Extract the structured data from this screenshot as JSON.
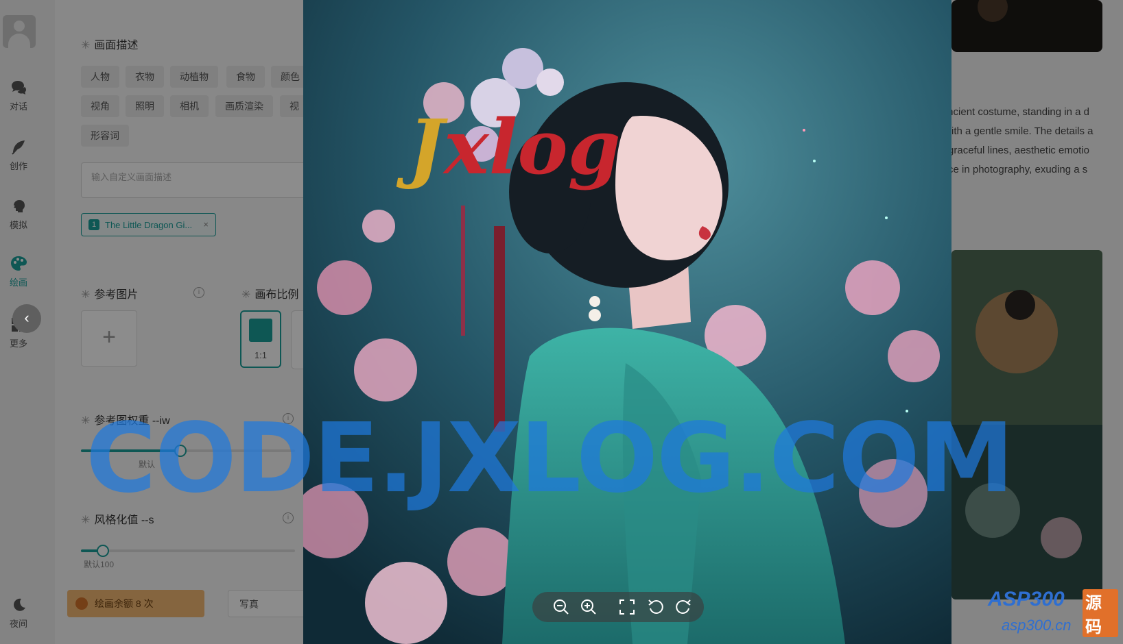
{
  "nav": {
    "items": [
      {
        "label": "对话",
        "icon": "chat-icon"
      },
      {
        "label": "创作",
        "icon": "feather-icon"
      },
      {
        "label": "模拟",
        "icon": "head-icon"
      },
      {
        "label": "绘画",
        "icon": "palette-icon"
      },
      {
        "label": "更多",
        "icon": "grid-icon"
      }
    ],
    "night_label": "夜间",
    "collapse_glyph": "‹"
  },
  "panel": {
    "desc_title": "画面描述",
    "tags_row1": [
      "人物",
      "衣物",
      "动植物",
      "食物",
      "颜色"
    ],
    "tags_row2": [
      "视角",
      "照明",
      "相机",
      "画质渲染",
      "视"
    ],
    "tags_row3": [
      "形容词"
    ],
    "textarea_placeholder": "输入自定义画面描述",
    "chip": {
      "num": "1",
      "text": "The Little Dragon Gi...",
      "close": "×"
    },
    "ref_title": "参考图片",
    "ratio_title": "画布比例",
    "ratio_label": "1:1",
    "iw_title": "参考图权重 --iw",
    "iw_default": "默认",
    "iw_level": 0.46,
    "s_title": "风格化值 --s",
    "s_default": "默认100",
    "s_level": 0.1,
    "quota_prefix": "绘画余额",
    "quota_count": "8",
    "quota_unit": "次",
    "style_value": "写真"
  },
  "results": {
    "text_lines": [
      "id ancient costume, standing in a d",
      "ky with a gentle smile. The details a",
      "ng, graceful lines, aesthetic emotio",
      "rpiece in photography, exuding a s"
    ]
  },
  "watermarks": {
    "main": "CODE.JXLOG.COM",
    "logo_a": "J",
    "logo_b": "xlog",
    "badge_a": "ASP300",
    "badge_b": "源码",
    "badge_c": "asp300.cn"
  },
  "toolbar": [
    "zoom-out-icon",
    "zoom-in-icon",
    "fullscreen-icon",
    "rotate-left-icon",
    "rotate-right-icon"
  ],
  "colors": {
    "accent": "#1a9e9a",
    "quota": "#f2b874",
    "watermark": "#1e78dc"
  }
}
